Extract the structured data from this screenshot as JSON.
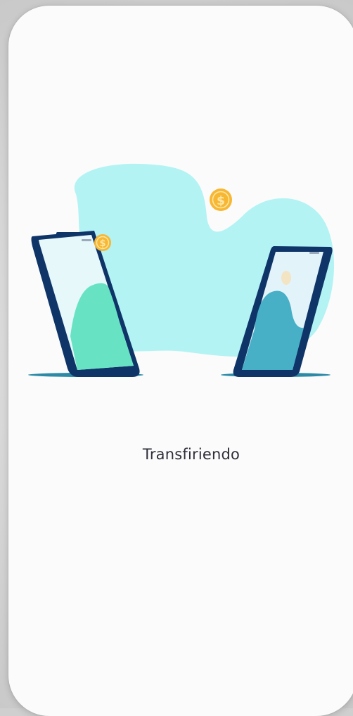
{
  "status": {
    "label": "Transfiriendo"
  },
  "illustration": {
    "icons": [
      "phone-left-icon",
      "phone-right-icon",
      "coin-dollar-icon",
      "coin-dollar-icon"
    ],
    "coin_symbol": "$",
    "colors": {
      "blob": "#b3f3f3",
      "phone_frame": "#0e3468",
      "left_screen": "#e7f8fb",
      "left_hill": "#67e3c4",
      "right_screen": "#e2f4fa",
      "right_hill": "#47afc6",
      "coin": "#f7b733",
      "shadow": "#2c8aa6"
    }
  }
}
